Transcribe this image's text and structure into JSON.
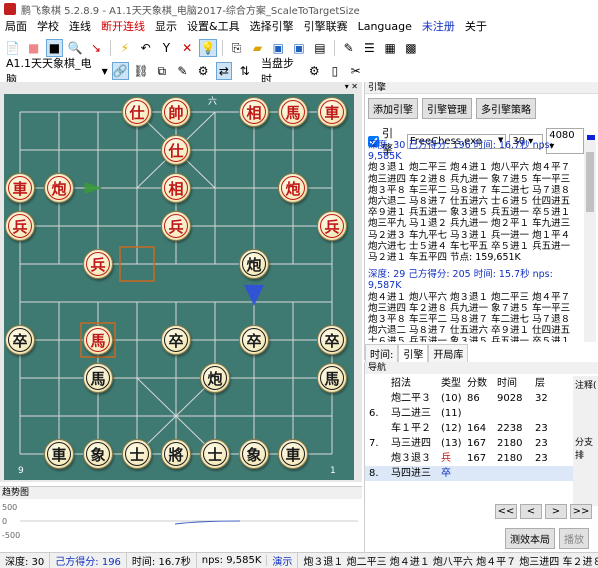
{
  "title": "鹏飞象棋 5.2.8.9 - A1.1天天象棋_电脑2017-综合方案_ScaleToTargetSize",
  "menu": [
    "局面",
    "学校",
    "连线",
    "断开连线",
    "显示",
    "设置&工具",
    "选择引擎",
    "引擎联赛",
    "Language",
    "未注册",
    "关于"
  ],
  "toolbar2": {
    "game_name": "A1.1天天象棋_电脑",
    "step_label": "当盘步时"
  },
  "board": {
    "top_marks": [
      "1",
      "2",
      "3",
      "4",
      "5",
      "6",
      "7",
      "8",
      "9"
    ],
    "bottom_marks": [
      "9",
      "8",
      "7",
      "6",
      "5",
      "4",
      "3",
      "2",
      "1"
    ],
    "top_mark_visible": "六",
    "bottom_left": "9",
    "bottom_right": "1"
  },
  "pieces": [
    {
      "t": "仕",
      "c": "r",
      "x": 4,
      "y": 0
    },
    {
      "t": "帥",
      "c": "r",
      "x": 5,
      "y": 0
    },
    {
      "t": "相",
      "c": "r",
      "x": 7,
      "y": 0
    },
    {
      "t": "馬",
      "c": "r",
      "x": 8,
      "y": 0
    },
    {
      "t": "車",
      "c": "r",
      "x": 9,
      "y": 0
    },
    {
      "t": "仕",
      "c": "r",
      "x": 5,
      "y": 1
    },
    {
      "t": "車",
      "c": "r",
      "x": 1,
      "y": 2
    },
    {
      "t": "炮",
      "c": "r",
      "x": 2,
      "y": 2
    },
    {
      "t": "相",
      "c": "r",
      "x": 5,
      "y": 2
    },
    {
      "t": "炮",
      "c": "r",
      "x": 8,
      "y": 2
    },
    {
      "t": "兵",
      "c": "r",
      "x": 1,
      "y": 3
    },
    {
      "t": "兵",
      "c": "r",
      "x": 5,
      "y": 3
    },
    {
      "t": "兵",
      "c": "r",
      "x": 9,
      "y": 3
    },
    {
      "t": "兵",
      "c": "r",
      "x": 3,
      "y": 4
    },
    {
      "t": "炮",
      "c": "b",
      "x": 7,
      "y": 4
    },
    {
      "t": "卒",
      "c": "b",
      "x": 1,
      "y": 6
    },
    {
      "t": "馬",
      "c": "r",
      "x": 3,
      "y": 6
    },
    {
      "t": "卒",
      "c": "b",
      "x": 5,
      "y": 6
    },
    {
      "t": "卒",
      "c": "b",
      "x": 7,
      "y": 6
    },
    {
      "t": "卒",
      "c": "b",
      "x": 9,
      "y": 6
    },
    {
      "t": "馬",
      "c": "b",
      "x": 3,
      "y": 7
    },
    {
      "t": "炮",
      "c": "b",
      "x": 6,
      "y": 7
    },
    {
      "t": "馬",
      "c": "b",
      "x": 9,
      "y": 7
    },
    {
      "t": "車",
      "c": "b",
      "x": 2,
      "y": 9
    },
    {
      "t": "象",
      "c": "b",
      "x": 3,
      "y": 9
    },
    {
      "t": "士",
      "c": "b",
      "x": 4,
      "y": 9
    },
    {
      "t": "將",
      "c": "b",
      "x": 5,
      "y": 9
    },
    {
      "t": "士",
      "c": "b",
      "x": 6,
      "y": 9
    },
    {
      "t": "象",
      "c": "b",
      "x": 7,
      "y": 9
    },
    {
      "t": "車",
      "c": "b",
      "x": 8,
      "y": 9
    }
  ],
  "mapbox": {
    "title": "趋势图",
    "ticks": [
      "500",
      "0",
      "-500"
    ]
  },
  "engine": {
    "title": "引擎",
    "btn_add": "添加引擎",
    "btn_manage": "引擎管理",
    "btn_multi": "多引擎策略",
    "check_label": "引擎",
    "exe": "FreeChess.exe",
    "depth": "30",
    "hash": "4080",
    "block1_head": "深度: 30  己方得分: 196  时间: 16.7秒  nps: 9,585K",
    "block1": [
      "炮３退１ 炮二平三 炮４进１ 炮八平六 炮４平７",
      "炮三进四 车２进８ 兵九进一 象７进５ 车一平三",
      "炮３平８ 车三平二 马８进７ 车二进七 马７退８",
      "炮六退二 马８进７ 仕五进六 士６进５ 仕四进五",
      "卒９进１ 兵五进一 象３进５ 兵五进一 卒５进１",
      "炮三平九 马１退２ 兵九进一 炮２平１ 车九进三",
      "马２进３ 车九平七 马３进１ 兵一进一 炮１平４",
      "炮六进七 士５进４ 车七平五 卒５进１ 兵五进一",
      "马２进１ 车五平四  节点: 159,651K"
    ],
    "block2_head": "深度: 29  己方得分: 205  时间: 15.7秒  nps: 9,587K",
    "block2": [
      "炮４进１ 炮八平六 炮３退１ 炮二平三 炮４平７",
      "炮三进四 车２进８ 兵九进一 象７进５ 车一平三",
      "炮３平８ 车三平二 马８进７ 车二进七 马７退８",
      "炮六退二 马８进７ 仕五进六 卒９进１ 仕四进五",
      "士６进５ 兵五进一 象３进５ 兵五进一 卒５进１"
    ],
    "tabs": [
      "时间:",
      "引擎",
      "开局库"
    ]
  },
  "nav": {
    "title": "导航",
    "headers": [
      "",
      "招法",
      "类型",
      "分数",
      "时间",
      "层"
    ],
    "rows": [
      [
        "",
        "炮二平３",
        "(10)",
        "86",
        "9028",
        "32"
      ],
      [
        "6.",
        "马二进三",
        "(11)",
        "",
        "",
        ""
      ],
      [
        "",
        "车１平２",
        "(12)",
        "164",
        "2238",
        "23"
      ],
      [
        "7.",
        "马三进四",
        "(13)",
        "167",
        "2180",
        "23"
      ],
      [
        "",
        "炮３退３",
        "兵",
        "167",
        "2180",
        "23"
      ],
      [
        "8.",
        "马四进三",
        "卒",
        "",
        "",
        ""
      ]
    ],
    "side_label": "注释(",
    "side_label2": "分支排",
    "btns": [
      "<<",
      "<",
      ">",
      ">>"
    ],
    "btn_calc": "测效本局",
    "btn_play": "播放"
  },
  "status": [
    "深度: 30",
    "己方得分: 196",
    "时间: 16.7秒",
    "nps: 9,585K",
    "演示",
    "炮３退１ 炮二平三 炮４进１ 炮八平六 炮４平７ 炮三进四 车２进８ 兵九进一"
  ]
}
